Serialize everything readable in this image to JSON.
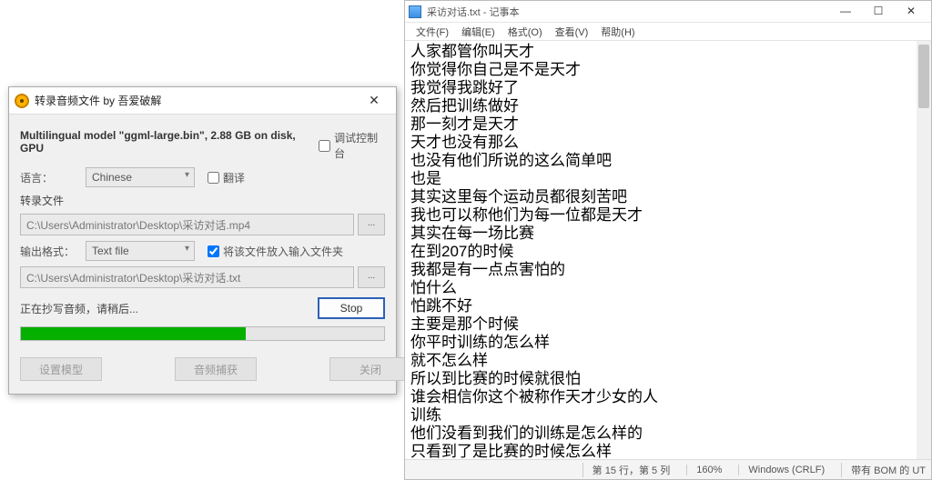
{
  "dialog": {
    "title": "转录音频文件 by 吾爱破解",
    "model_line": "Multilingual model \"ggml-large.bin\", 2.88 GB on disk, GPU",
    "debug_label": "调试控制台",
    "lang_label": "语言：",
    "lang_value": "Chinese",
    "translate_label": "翻译",
    "file_section": "转录文件",
    "input_path": "C:\\Users\\Administrator\\Desktop\\采访对话.mp4",
    "out_fmt_label": "输出格式：",
    "out_fmt_value": "Text file",
    "put_in_folder_label": "将该文件放入输入文件夹",
    "output_path": "C:\\Users\\Administrator\\Desktop\\采访对话.txt",
    "status_text": "正在抄写音频，请稍后...",
    "stop_label": "Stop",
    "set_model": "设置模型",
    "audio_capture": "音频捕获",
    "close": "关闭"
  },
  "notepad": {
    "title": "采访对话.txt - 记事本",
    "menu": [
      "文件(F)",
      "编辑(E)",
      "格式(O)",
      "查看(V)",
      "帮助(H)"
    ],
    "lines": [
      "人家都管你叫天才",
      "你觉得你自己是不是天才",
      "我觉得我跳好了",
      "然后把训练做好",
      "那一刻才是天才",
      "天才也没有那么",
      "也没有他们所说的这么简单吧",
      "也是",
      "其实这里每个运动员都很刻苦吧",
      "我也可以称他们为每一位都是天才",
      "其实在每一场比赛",
      "在到207的时候",
      "我都是有一点点害怕的",
      "怕什么",
      "怕跳不好",
      "主要是那个时候",
      "你平时训练的怎么样",
      "就不怎么样",
      "所以到比赛的时候就很怕",
      "谁会相信你这个被称作天才少女的人",
      "训练",
      "他们没看到我们的训练是怎么样的",
      "只看到了是比赛的时候怎么样"
    ],
    "status": {
      "pos": "第 15 行，第 5 列",
      "zoom": "160%",
      "eol": "Windows (CRLF)",
      "enc": "带有 BOM 的 UT"
    }
  }
}
